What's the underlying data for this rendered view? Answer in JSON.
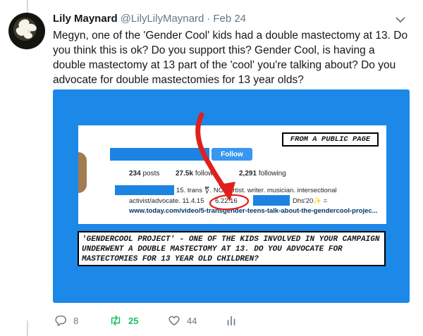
{
  "tweet": {
    "author_name": "Lily Maynard",
    "author_handle": "@LilyLilyMaynard",
    "separator": "·",
    "date": "Feb 24",
    "text": "Megyn, one of the 'Gender Cool' kids had a double mastectomy at 13. Do you think this is ok? Do you support this? Gender Cool, is having a double mastectomy at 13 part of the 'cool' you're talking about? Do you advocate for double mastectomies for 13 year olds?"
  },
  "media": {
    "caption_top": "FROM A PUBLIC PAGE",
    "follow_label": "Follow",
    "posts_count": "234",
    "posts_label": "posts",
    "followers_count": "27.5k",
    "followers_label": "follow",
    "following_count": "2,291",
    "following_label": "following",
    "bio_line1": "15. trans ⚧. NC · artist. writer. musician. intersectional",
    "bio_line2": "activist/advocate. 11.4.15",
    "bio_date": "6.22.16",
    "bio_dhs": "Dhs'20✨ =",
    "link": "www.today.com/video/5-transgender-teens-talk-about-the-gendercool-projec...",
    "quote": "'GENDERCOOL PROJECT' - ONE OF THE KIDS INVOLVED IN YOUR CAMPAIGN UNDERWENT A DOUBLE MASTECTOMY AT 13. DO YOU ADVOCATE FOR MASTECTOMIES FOR 13 YEAR OLD CHILDREN?"
  },
  "actions": {
    "reply_count": "8",
    "retweet_count": "25",
    "like_count": "44"
  },
  "icons": [
    "reply-icon",
    "retweet-icon",
    "like-icon",
    "analytics-icon",
    "chevron-down-icon"
  ],
  "colors": {
    "media_bg": "#1c88e8",
    "retweet_active": "#17bf63",
    "meta_gray": "#657786",
    "arrow_red": "#e0201c"
  }
}
